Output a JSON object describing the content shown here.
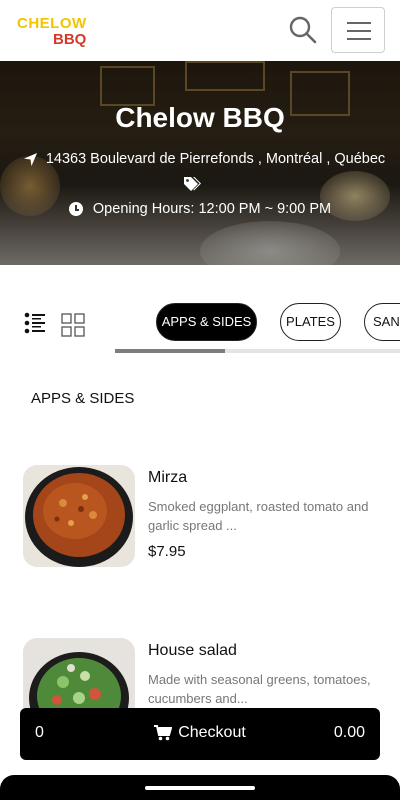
{
  "header": {
    "logo_line1": "CHELOW",
    "logo_line2": "BBQ",
    "search_icon": "search-icon",
    "menu_icon": "hamburger-menu-icon"
  },
  "hero": {
    "title": "Chelow BBQ",
    "address": "14363 Boulevard de Pierrefonds , Montréal , Québec",
    "hours": "Opening Hours: 12:00 PM ~ 9:00 PM",
    "icons": [
      "location-arrow-icon",
      "tags-icon",
      "clock-icon"
    ]
  },
  "categories": {
    "tabs": [
      {
        "label": "APPS & SIDES",
        "active": true
      },
      {
        "label": "PLATES",
        "active": false
      },
      {
        "label": "SANDWICHES",
        "active": false
      }
    ]
  },
  "section": {
    "title": "APPS & SIDES"
  },
  "items": [
    {
      "name": "Mirza",
      "description": "Smoked eggplant, roasted tomato and garlic spread ...",
      "price": "$7.95"
    },
    {
      "name": "House salad",
      "description": "Made with seasonal greens, tomatoes, cucumbers and...",
      "price": ""
    }
  ],
  "checkout": {
    "count": "0",
    "label": "Checkout",
    "total": "0.00"
  },
  "colors": {
    "logo_yellow": "#f2c500",
    "logo_red": "#d43a2a",
    "accent": "#000000"
  }
}
